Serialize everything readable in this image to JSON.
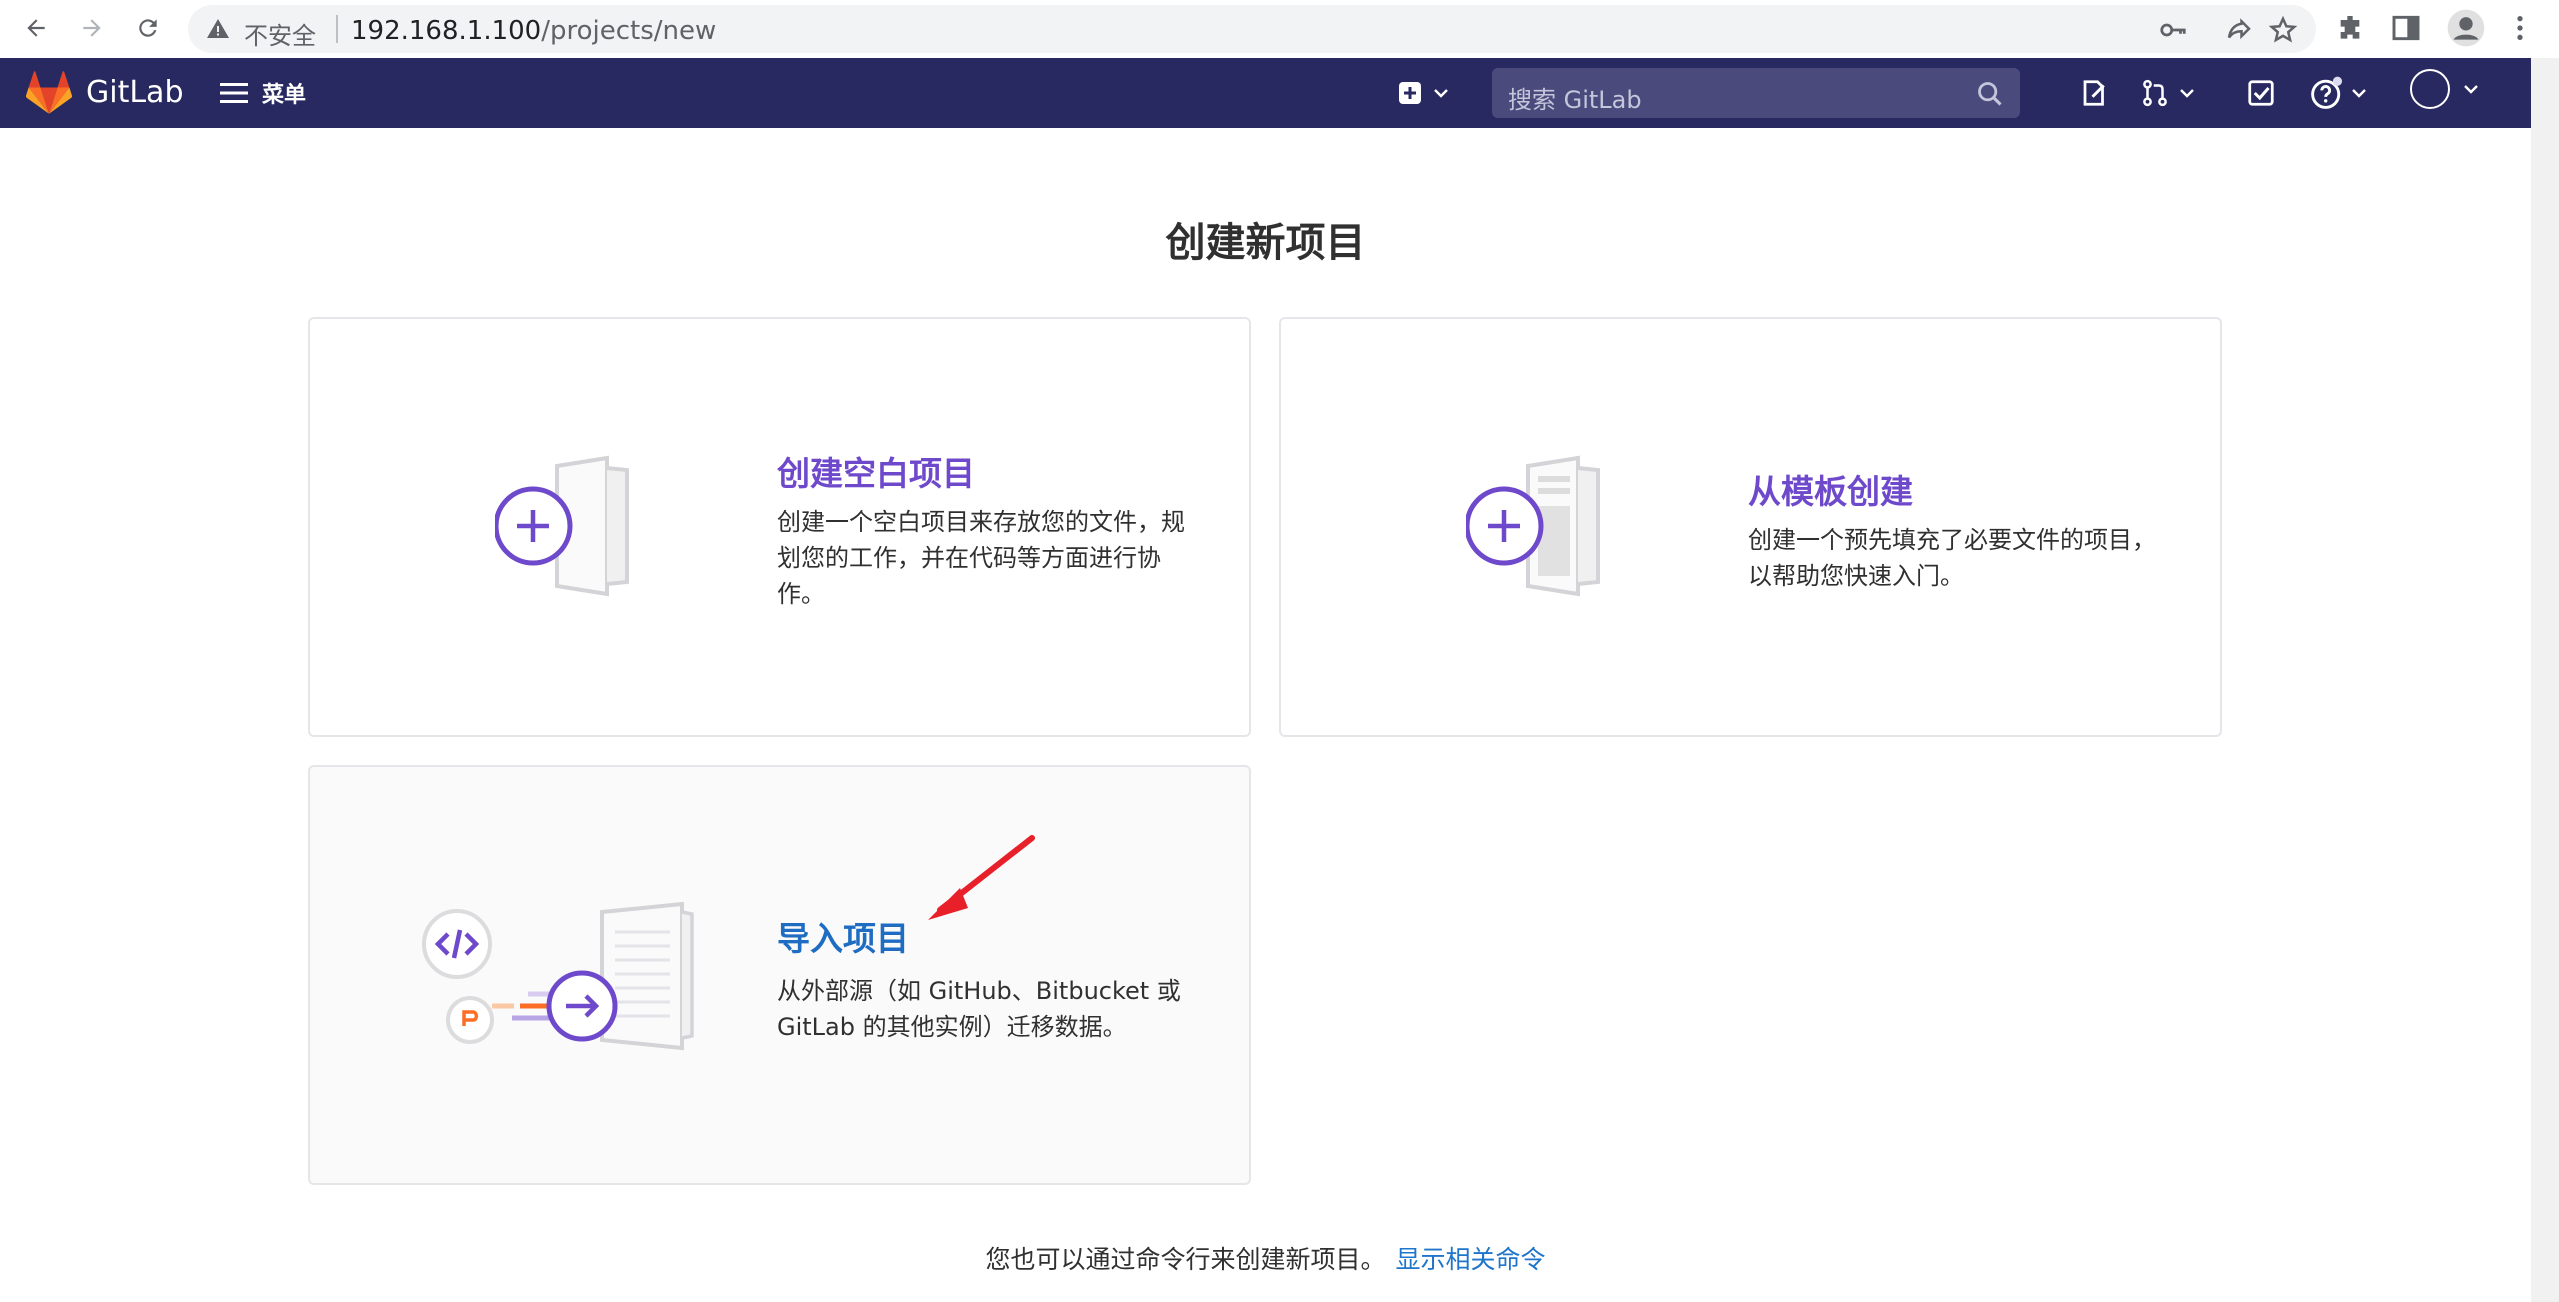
{
  "browser": {
    "insecure_label": "不安全",
    "url_host": "192.168.1.100",
    "url_path": "/projects/new"
  },
  "navbar": {
    "brand": "GitLab",
    "menu_label": "菜单",
    "search_placeholder": "搜索 GitLab"
  },
  "page": {
    "title": "创建新项目"
  },
  "cards": {
    "blank": {
      "title": "创建空白项目",
      "description": "创建一个空白项目来存放您的文件，规划您的工作，并在代码等方面进行协作。"
    },
    "template": {
      "title": "从模板创建",
      "description": "创建一个预先填充了必要文件的项目，以帮助您快速入门。"
    },
    "import": {
      "title": "导入项目",
      "description": "从外部源（如 GitHub、Bitbucket 或 GitLab 的其他实例）迁移数据。"
    }
  },
  "footer": {
    "text": "您也可以通过命令行来创建新项目。",
    "link": "显示相关命令"
  },
  "colors": {
    "navbar_bg": "#292961",
    "accent_purple": "#6e49cb",
    "link_blue": "#1f75cb",
    "annotation_red": "#e8202a"
  }
}
